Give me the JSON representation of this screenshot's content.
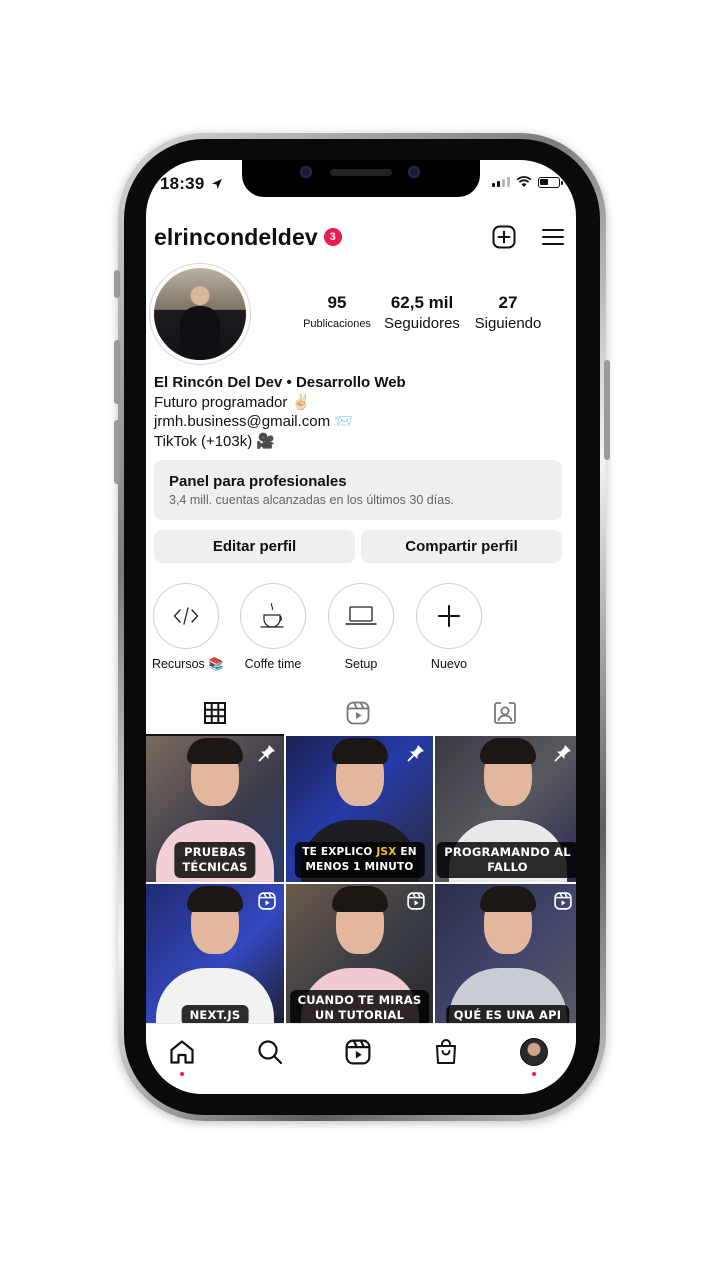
{
  "status_bar": {
    "time": "18:39"
  },
  "header": {
    "username": "elrincondeldev",
    "notification_count": "3"
  },
  "stats": [
    {
      "value": "95",
      "label": "Publicaciones"
    },
    {
      "value": "62,5 mil",
      "label": "Seguidores"
    },
    {
      "value": "27",
      "label": "Siguiendo"
    }
  ],
  "bio": {
    "name": "El Rincón Del Dev • Desarrollo Web",
    "line1": "Futuro programador ✌🏻",
    "line2": "jrmh.business@gmail.com 📨",
    "line3": "TikTok (+103k) 🎥"
  },
  "pro_panel": {
    "title": "Panel para profesionales",
    "subtitle": "3,4 mill. cuentas alcanzadas en los últimos 30 días."
  },
  "buttons": {
    "edit": "Editar perfil",
    "share": "Compartir perfil"
  },
  "highlights": [
    {
      "label": "Recursos 📚",
      "icon": "code-icon"
    },
    {
      "label": "Coffe time",
      "icon": "coffee-cup-icon"
    },
    {
      "label": "Setup",
      "icon": "laptop-icon"
    },
    {
      "label": "Nuevo",
      "icon": "plus-icon"
    }
  ],
  "tabs": [
    {
      "icon": "grid-icon",
      "active": true
    },
    {
      "icon": "reels-icon",
      "active": false
    },
    {
      "icon": "tagged-icon",
      "active": false
    }
  ],
  "posts": [
    {
      "caption": [
        "PRUEBAS",
        "TÉCNICAS"
      ],
      "badge": "pin-icon"
    },
    {
      "caption": [
        "TE EXPLICO JSX EN",
        "MENOS 1 MINUTO"
      ],
      "highlight": "JSX",
      "badge": "pin-icon"
    },
    {
      "caption": [
        "PROGRAMANDO AL",
        "FALLO"
      ],
      "badge": "pin-icon"
    },
    {
      "caption": [
        "NEXT.JS"
      ],
      "badge": "reel-icon"
    },
    {
      "caption": [
        "CUANDO TE MIRAS",
        "UN TUTORIAL"
      ],
      "badge": "reel-icon"
    },
    {
      "caption": [
        "QUÉ ES UNA API"
      ],
      "badge": "reel-icon"
    }
  ],
  "bottom_nav": [
    "home-icon",
    "search-icon",
    "reels-icon",
    "shop-icon",
    "profile-avatar"
  ],
  "colors": {
    "accent": "#ee1a4f",
    "panel": "#efefef"
  }
}
